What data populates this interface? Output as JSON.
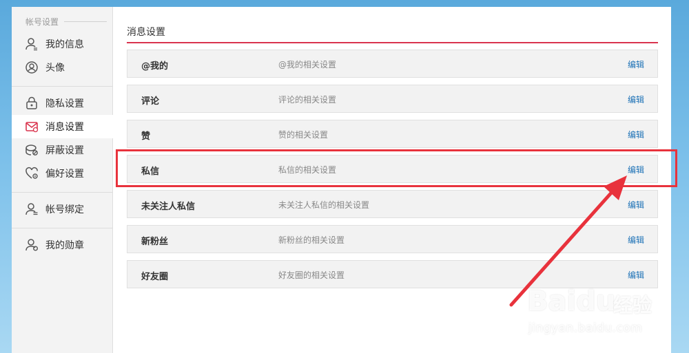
{
  "sidebar": {
    "section_title": "帐号设置",
    "items": [
      {
        "label": "我的信息",
        "icon": "user-icon"
      },
      {
        "label": "头像",
        "icon": "avatar-icon"
      },
      {
        "label": "隐私设置",
        "icon": "lock-icon"
      },
      {
        "label": "消息设置",
        "icon": "mail-icon",
        "active": true
      },
      {
        "label": "屏蔽设置",
        "icon": "block-icon"
      },
      {
        "label": "偏好设置",
        "icon": "heart-gear-icon"
      },
      {
        "label": "帐号绑定",
        "icon": "user-link-icon"
      },
      {
        "label": "我的勋章",
        "icon": "user-medal-icon"
      }
    ]
  },
  "main": {
    "title": "消息设置",
    "rows": [
      {
        "name": "@我的",
        "desc": "@我的相关设置",
        "edit": "编辑"
      },
      {
        "name": "评论",
        "desc": "评论的相关设置",
        "edit": "编辑"
      },
      {
        "name": "赞",
        "desc": "赞的相关设置",
        "edit": "编辑"
      },
      {
        "name": "私信",
        "desc": "私信的相关设置",
        "edit": "编辑"
      },
      {
        "name": "未关注人私信",
        "desc": "未关注人私信的相关设置",
        "edit": "编辑"
      },
      {
        "name": "新粉丝",
        "desc": "新粉丝的相关设置",
        "edit": "编辑"
      },
      {
        "name": "好友圈",
        "desc": "好友圈的相关设置",
        "edit": "编辑"
      }
    ]
  },
  "watermark": {
    "brand": "Baidu",
    "brand_cn": "经验",
    "url": "jingyan.baidu.com"
  },
  "colors": {
    "accent": "#d9334d",
    "link": "#1f73b7",
    "annotation": "#e8323c"
  }
}
